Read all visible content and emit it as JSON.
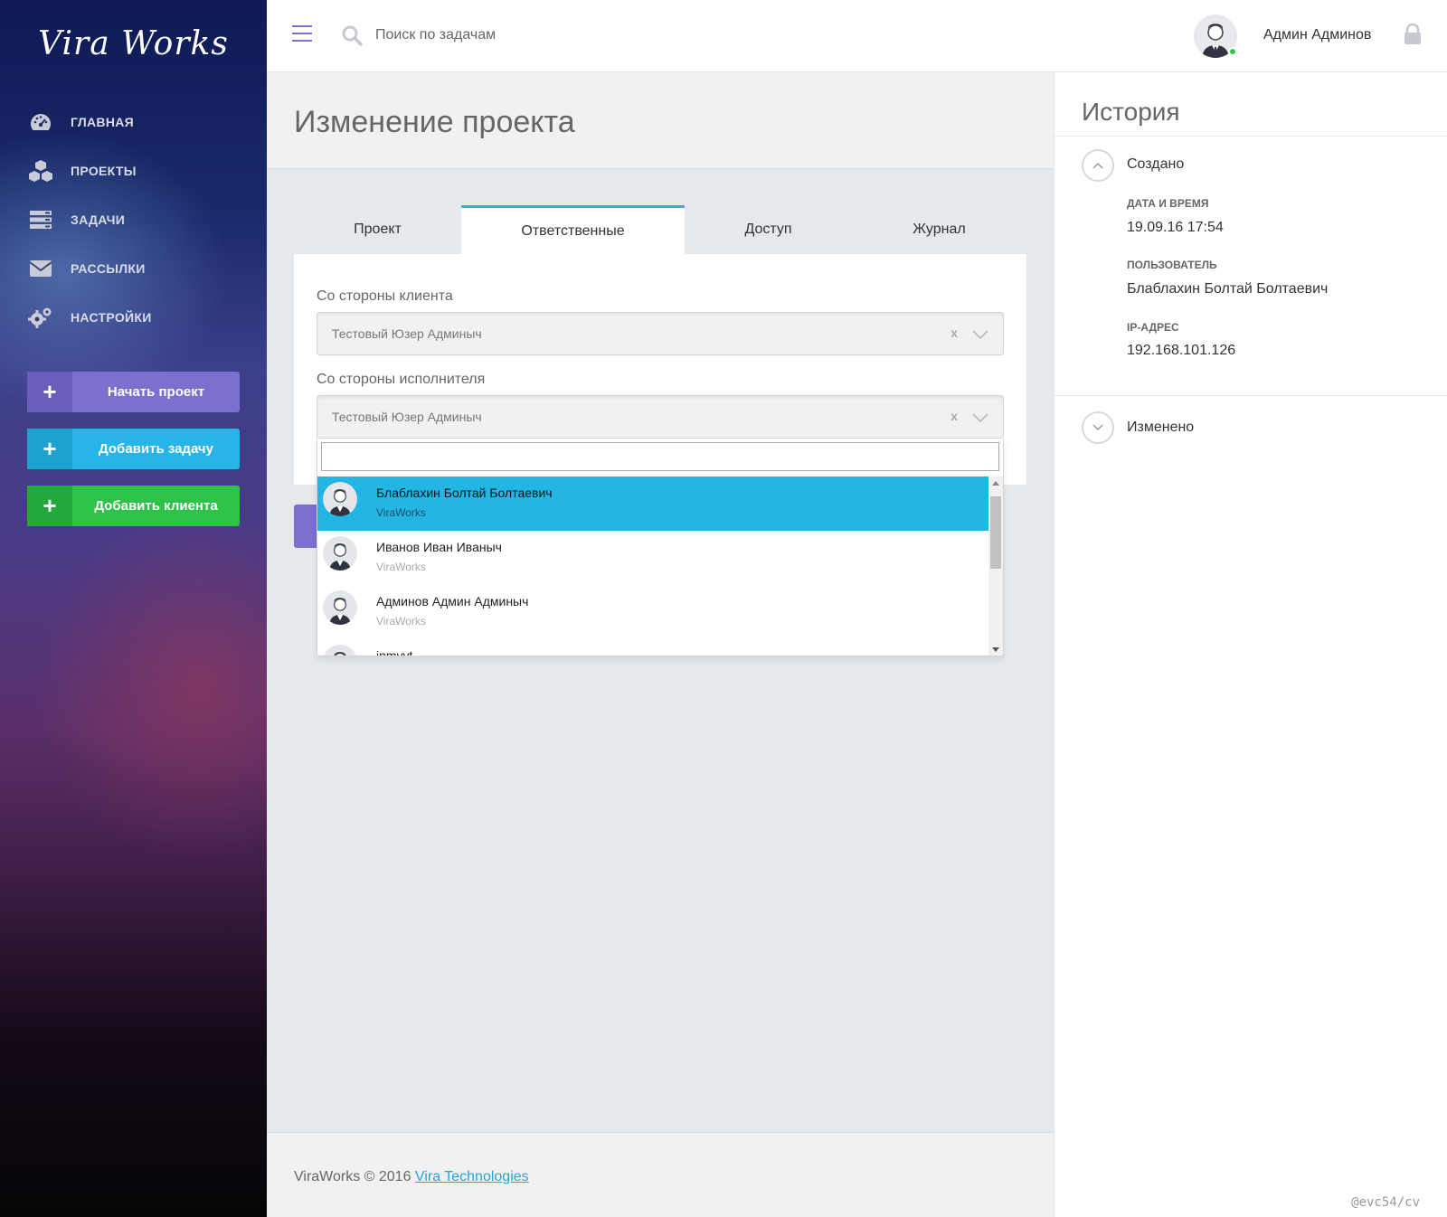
{
  "app": {
    "logo": "Vira Works"
  },
  "sidebar": {
    "nav": [
      {
        "label": "ГЛАВНАЯ",
        "icon": "dashboard-icon"
      },
      {
        "label": "ПРОЕКТЫ",
        "icon": "cubes-icon"
      },
      {
        "label": "ЗАДАЧИ",
        "icon": "tasks-icon"
      },
      {
        "label": "РАССЫЛКИ",
        "icon": "envelope-icon"
      },
      {
        "label": "НАСТРОЙКИ",
        "icon": "gears-icon"
      }
    ],
    "buttons": [
      {
        "label": "Начать проект",
        "color": "#7b6fd0",
        "plus_bg": "#6a5ebd",
        "icon": "plus-icon"
      },
      {
        "label": "Добавить задачу",
        "color": "#27b4e6",
        "plus_bg": "#1ea1d0",
        "icon": "plus-icon"
      },
      {
        "label": "Добавить клиента",
        "color": "#2ec24a",
        "plus_bg": "#23a83b",
        "icon": "plus-icon"
      }
    ]
  },
  "topbar": {
    "search_placeholder": "Поиск по задачам",
    "user_name": "Админ Админов",
    "status_color": "#2ecc40"
  },
  "page": {
    "title": "Изменение проекта",
    "tabs": [
      "Проект",
      "Ответственные",
      "Доступ",
      "Журнал"
    ],
    "active_tab": "Ответственные"
  },
  "form": {
    "client_label": "Со стороны клиента",
    "client_value": "Тестовый Юзер Админыч",
    "contractor_label": "Со стороны исполнителя",
    "contractor_value": "Тестовый Юзер Админыч",
    "clear_symbol": "x"
  },
  "dropdown": {
    "search_value": "",
    "options": [
      {
        "name": "Блаблахин Болтай Болтаевич",
        "company": "ViraWorks",
        "highlighted": true
      },
      {
        "name": "Иванов Иван Иваныч",
        "company": "ViraWorks",
        "highlighted": false
      },
      {
        "name": "Админов Админ Админыч",
        "company": "ViraWorks",
        "highlighted": false
      },
      {
        "name": "inmyyt",
        "company": "",
        "highlighted": false
      }
    ],
    "highlight_color": "#23b6e4"
  },
  "footer": {
    "text": "ViraWorks © 2016 ",
    "link": "Vira Technologies",
    "link_color": "#29a3d4"
  },
  "history": {
    "title": "История",
    "created": {
      "heading": "Создано",
      "date_label": "ДАТА И ВРЕМЯ",
      "date_value": "19.09.16 17:54",
      "user_label": "ПОЛЬЗОВАТЕЛЬ",
      "user_value": "Блаблахин Болтай Болтаевич",
      "ip_label": "IP-АДРЕС",
      "ip_value": "192.168.101.126"
    },
    "changed": {
      "heading": "Изменено"
    }
  },
  "watermark": "@evc54/cv"
}
